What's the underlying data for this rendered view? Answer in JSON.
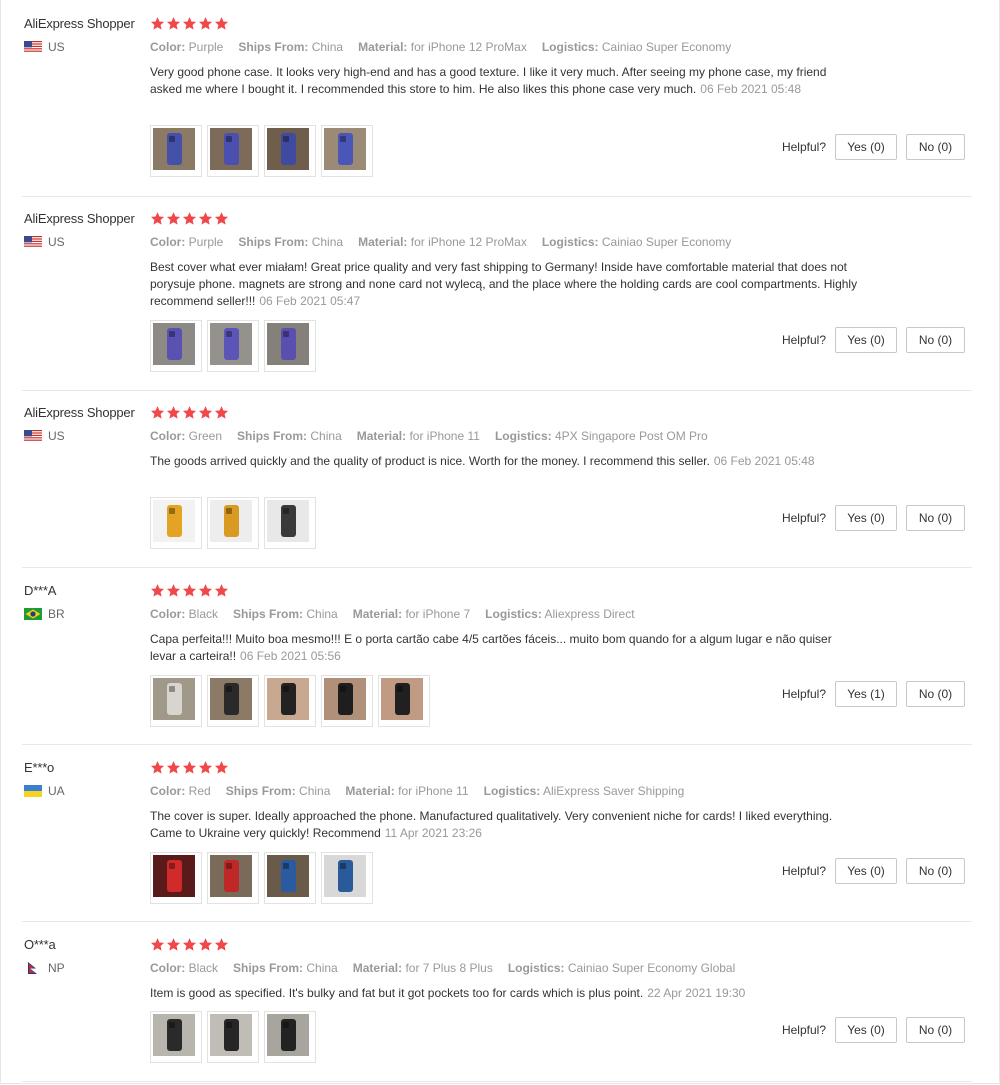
{
  "labels": {
    "color": "Color:",
    "ships_from": "Ships From:",
    "material": "Material:",
    "logistics": "Logistics:",
    "helpful": "Helpful?"
  },
  "colors": {
    "star": "#f04848",
    "text": "#333333",
    "muted": "#999999",
    "border": "#c8c8c8"
  },
  "reviews": [
    {
      "user": "AliExpress Shopper",
      "country": "US",
      "flag_icon": "us-flag-icon",
      "rating": 5,
      "color": "Purple",
      "ships_from": "China",
      "material": "for iPhone 12 ProMax",
      "logistics": "Cainiao Super Economy",
      "text": "Very good phone case. It looks very high-end and has a good texture. I like it very much. After seeing my phone case, my friend asked me where I bought it. I recommended this store to him. He also likes this phone case very much.",
      "date": "06 Feb 2021 05:48",
      "yes": "Yes (0)",
      "no": "No (0)",
      "photos": [
        {
          "icon": "purple-phone-case-photo",
          "bg": "#8a7a66",
          "fg": "#4550a8"
        },
        {
          "icon": "purple-phone-case-photo",
          "bg": "#7b6b58",
          "fg": "#4a4fb0"
        },
        {
          "icon": "purple-phone-case-photo",
          "bg": "#6f5e4c",
          "fg": "#3f4aa0"
        },
        {
          "icon": "purple-phone-case-photo",
          "bg": "#9b8a76",
          "fg": "#4a56b8"
        }
      ]
    },
    {
      "user": "AliExpress Shopper",
      "country": "US",
      "flag_icon": "us-flag-icon",
      "rating": 5,
      "color": "Purple",
      "ships_from": "China",
      "material": "for iPhone 12 ProMax",
      "logistics": "Cainiao Super Economy",
      "text": "Best cover what ever miałam! Great price quality and very fast shipping to Germany! Inside have comfortable material that does not porysuje phone. magnets are strong and none card not wylecą, and the place where the holding cards are cool compartments. Highly recommend seller!!!",
      "date": "06 Feb 2021 05:47",
      "yes": "Yes (0)",
      "no": "No (0)",
      "photos": [
        {
          "icon": "purple-phone-case-photo",
          "bg": "#8d8a86",
          "fg": "#5a52b0"
        },
        {
          "icon": "purple-phone-case-photo",
          "bg": "#95928e",
          "fg": "#5c55b8"
        },
        {
          "icon": "purple-phone-case-photo",
          "bg": "#84807a",
          "fg": "#5a4eae"
        }
      ]
    },
    {
      "user": "AliExpress Shopper",
      "country": "US",
      "flag_icon": "us-flag-icon",
      "rating": 5,
      "color": "Green",
      "ships_from": "China",
      "material": "for iPhone 11",
      "logistics": "4PX Singapore Post OM Pro",
      "text": "The goods arrived quickly and the quality of product is nice. Worth for the money. I recommend this seller.",
      "date": "06 Feb 2021 05:48",
      "yes": "Yes (0)",
      "no": "No (0)",
      "photos": [
        {
          "icon": "yellow-phone-case-photo",
          "bg": "#f2f2f2",
          "fg": "#e2a422"
        },
        {
          "icon": "yellow-phone-case-photo",
          "bg": "#ededed",
          "fg": "#d89a20"
        },
        {
          "icon": "yellow-phone-case-photo",
          "bg": "#e8e8e8",
          "fg": "#3a3a3a"
        }
      ]
    },
    {
      "user": "D***A",
      "country": "BR",
      "flag_icon": "brazil-flag-icon",
      "rating": 5,
      "color": "Black",
      "ships_from": "China",
      "material": "for iPhone 7",
      "logistics": "Aliexpress Direct",
      "text": "Capa perfeita!!! Muito boa mesmo!!! E o porta cartão cabe 4/5 cartões fáceis... muito bom quando for a algum lugar e não quiser levar a carteira!!",
      "date": "06 Feb 2021 05:56",
      "yes": "Yes (1)",
      "no": "No (0)",
      "photos": [
        {
          "icon": "package-photo",
          "bg": "#a09888",
          "fg": "#d8d4ce"
        },
        {
          "icon": "black-phone-case-photo",
          "bg": "#8a7a66",
          "fg": "#2a2a2a"
        },
        {
          "icon": "black-phone-case-photo",
          "bg": "#c8a890",
          "fg": "#222222"
        },
        {
          "icon": "black-phone-case-photo",
          "bg": "#b09078",
          "fg": "#1e1e1e"
        },
        {
          "icon": "black-phone-case-photo",
          "bg": "#c09a82",
          "fg": "#202020"
        }
      ]
    },
    {
      "user": "E***o",
      "country": "UA",
      "flag_icon": "ukraine-flag-icon",
      "rating": 5,
      "color": "Red",
      "ships_from": "China",
      "material": "for iPhone 11",
      "logistics": "AliExpress Saver Shipping",
      "text": "The cover is super. Ideally approached the phone. Manufactured qualitatively. Very convenient niche for cards! I liked everything. Came to Ukraine very quickly! Recommend",
      "date": "11 Apr 2021 23:26",
      "yes": "Yes (0)",
      "no": "No (0)",
      "photos": [
        {
          "icon": "red-phone-case-photo",
          "bg": "#5a1a1a",
          "fg": "#d02a2a"
        },
        {
          "icon": "red-phone-case-photo",
          "bg": "#7a6a5a",
          "fg": "#c02828"
        },
        {
          "icon": "blue-phone-case-photo",
          "bg": "#6a5a4a",
          "fg": "#2a5aa0"
        },
        {
          "icon": "blue-phone-case-photo",
          "bg": "#d8d8d8",
          "fg": "#2a5a9a"
        }
      ]
    },
    {
      "user": "O***a",
      "country": "NP",
      "flag_icon": "nepal-flag-icon",
      "rating": 5,
      "color": "Black",
      "ships_from": "China",
      "material": "for 7 Plus 8 Plus",
      "logistics": "Cainiao Super Economy Global",
      "text": "Item is good as specified. It's bulky and fat but it got pockets too for cards which is plus point.",
      "date": "22 Apr 2021 19:30",
      "yes": "Yes (0)",
      "no": "No (0)",
      "photos": [
        {
          "icon": "black-phone-case-photo",
          "bg": "#b8b4ae",
          "fg": "#2a2a2a"
        },
        {
          "icon": "black-phone-case-photo",
          "bg": "#c0bcb6",
          "fg": "#262626"
        },
        {
          "icon": "black-phone-case-photo",
          "bg": "#a8a49e",
          "fg": "#222222"
        }
      ]
    }
  ]
}
